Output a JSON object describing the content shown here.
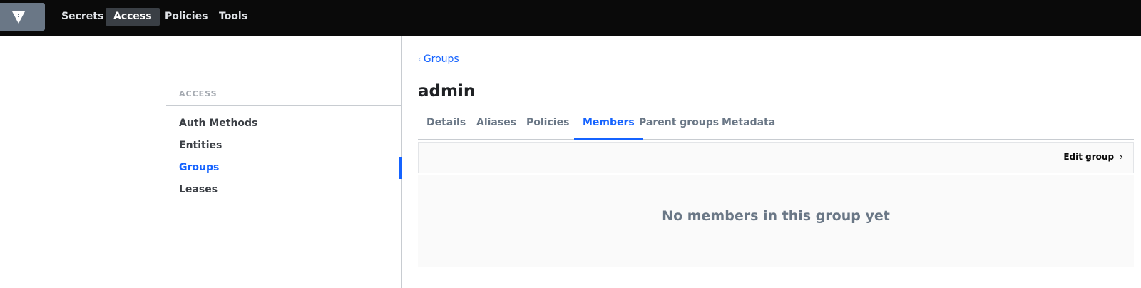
{
  "topnav": {
    "logo_icon": "vault-logo-icon",
    "items": [
      {
        "label": "Secrets",
        "active": false
      },
      {
        "label": "Access",
        "active": true
      },
      {
        "label": "Policies",
        "active": false
      },
      {
        "label": "Tools",
        "active": false
      }
    ]
  },
  "sidebar": {
    "heading": "ACCESS",
    "items": [
      {
        "label": "Auth Methods",
        "active": false
      },
      {
        "label": "Entities",
        "active": false
      },
      {
        "label": "Groups",
        "active": true
      },
      {
        "label": "Leases",
        "active": false
      }
    ]
  },
  "main": {
    "breadcrumb": {
      "chevron": "‹",
      "label": "Groups"
    },
    "title": "admin",
    "tabs": [
      {
        "label": "Details",
        "active": false
      },
      {
        "label": "Aliases",
        "active": false
      },
      {
        "label": "Policies",
        "active": false
      },
      {
        "label": "Members",
        "active": true
      },
      {
        "label": "Parent groups",
        "active": false
      },
      {
        "label": "Metadata",
        "active": false
      }
    ],
    "toolbar": {
      "edit_label": "Edit group",
      "arrow": "›"
    },
    "empty_message": "No members in this group yet"
  },
  "colors": {
    "accent": "#1563ff",
    "nav_bg": "#0a0a0a",
    "logo_bg": "#6a7786"
  }
}
